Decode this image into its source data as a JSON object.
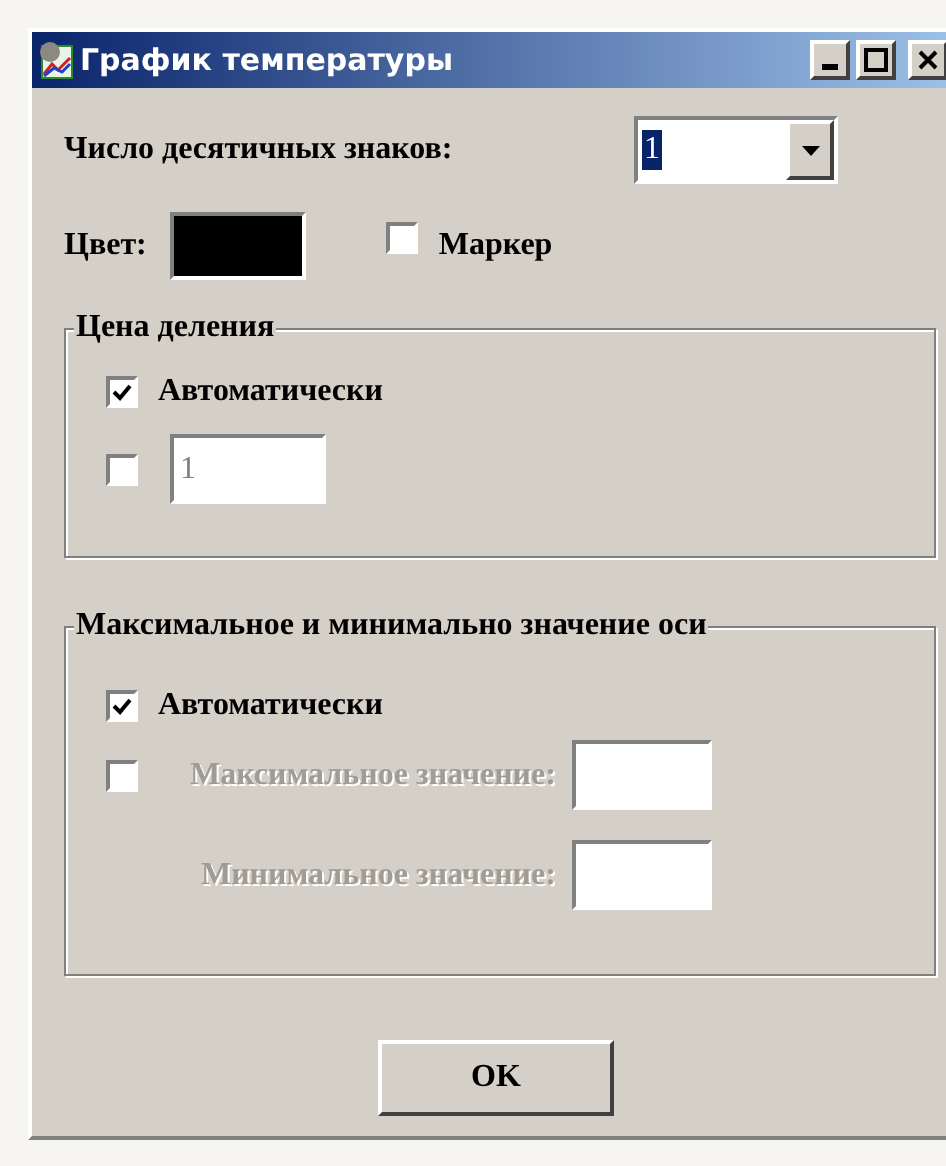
{
  "window": {
    "title": "График температуры"
  },
  "decimal_places": {
    "label": "Число десятичных знаков:",
    "value": "1"
  },
  "color": {
    "label": "Цвет:",
    "color": "#000000"
  },
  "marker": {
    "label": "Маркер",
    "checked": false
  },
  "division_group": {
    "title": "Цена деления",
    "auto": {
      "label": "Автоматически",
      "checked": true
    },
    "manual": {
      "checked": false,
      "value": "1",
      "disabled": true
    }
  },
  "axis_group": {
    "title": "Максимальное и минимально значение оси",
    "auto": {
      "label": "Автоматически",
      "checked": true
    },
    "manual": {
      "checked": false
    },
    "fields": [
      {
        "label": "Максимальное значение:",
        "disabled": true
      },
      {
        "label": "Минимальное значение:",
        "disabled": true
      }
    ]
  },
  "buttons": [
    "OK"
  ]
}
